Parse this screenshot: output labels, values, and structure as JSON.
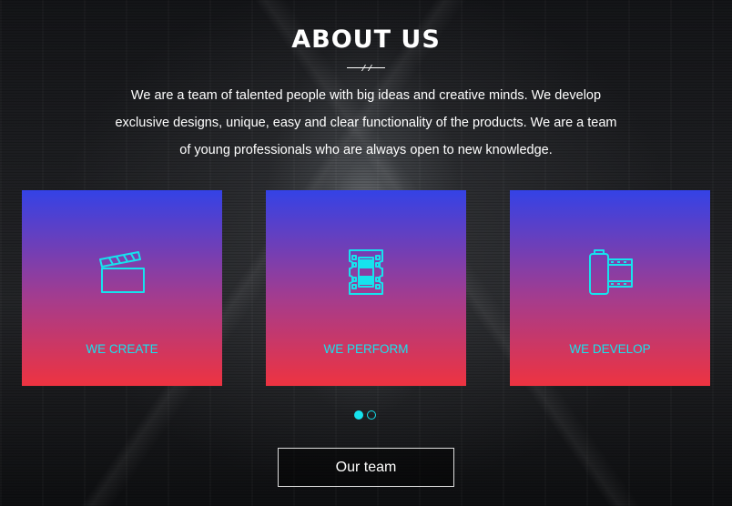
{
  "section": {
    "title": "ABOUT US",
    "intro": "We are a team of talented people with big ideas and creative minds. We develop exclusive designs, unique, easy and clear functionality of the products. We are a team of young professionals who are always open to new knowledge."
  },
  "cards": [
    {
      "label": "WE CREATE",
      "icon": "clapperboard-icon"
    },
    {
      "label": "WE PERFORM",
      "icon": "film-strip-icon"
    },
    {
      "label": "WE DEVELOP",
      "icon": "film-roll-icon"
    }
  ],
  "carousel": {
    "total": 2,
    "active": 1
  },
  "cta": {
    "label": "Our team"
  },
  "colors": {
    "accent": "#16e3ee",
    "border_top": "#3442e6",
    "border_bottom": "#ee3340"
  }
}
